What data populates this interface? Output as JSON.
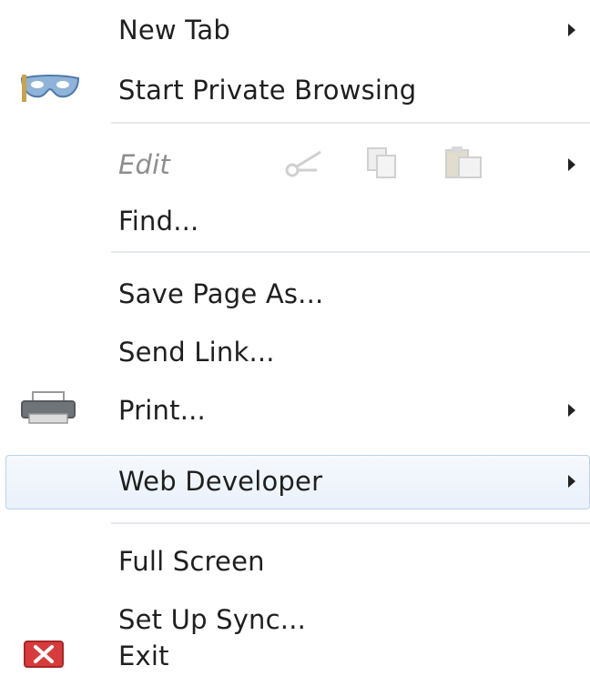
{
  "menu": {
    "items": [
      {
        "label": "New Tab"
      },
      {
        "label": "Start Private Browsing"
      },
      {
        "label": "Edit"
      },
      {
        "label": "Find..."
      },
      {
        "label": "Save Page As..."
      },
      {
        "label": "Send Link..."
      },
      {
        "label": "Print..."
      },
      {
        "label": "Web Developer"
      },
      {
        "label": "Full Screen"
      },
      {
        "label": "Set Up Sync..."
      },
      {
        "label": "Exit"
      }
    ]
  },
  "icons": {
    "private_browsing": "mask-icon",
    "print": "printer-icon",
    "exit": "close-icon",
    "edit_tools": [
      "cut-icon",
      "copy-icon",
      "paste-icon"
    ],
    "submenu": "chevron-right-icon"
  },
  "colors": {
    "text": "#1f1f1f",
    "disabled_text": "#8d8d8d",
    "separator": "#e6e9ee",
    "highlight_border": "#bcd2ea",
    "exit_red": "#d73b3b"
  }
}
